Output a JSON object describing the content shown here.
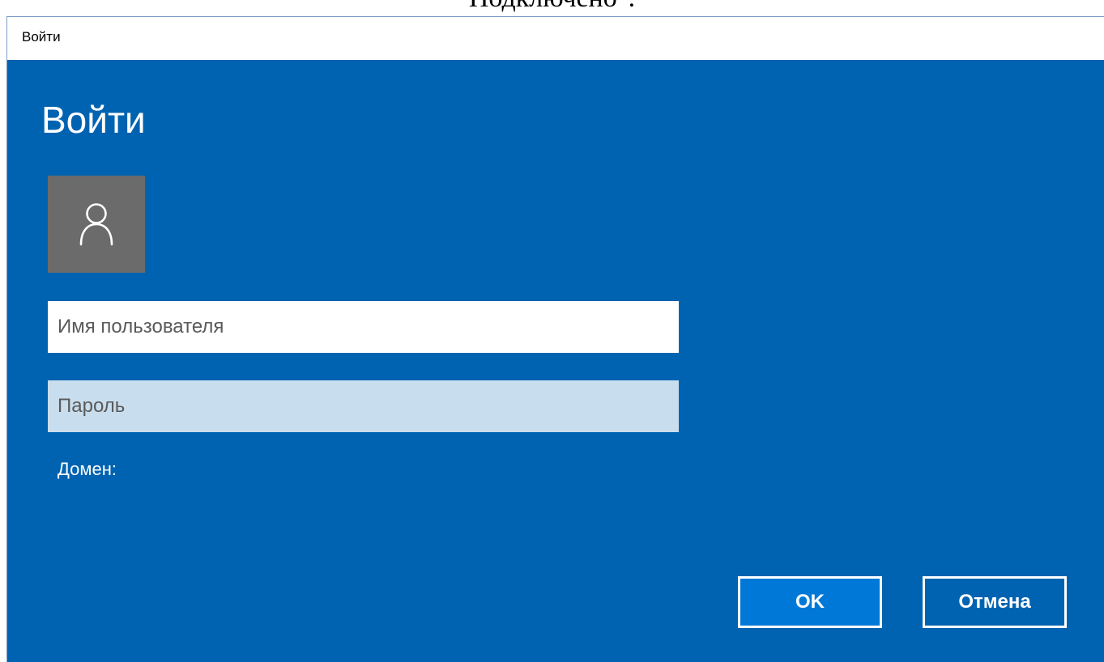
{
  "background_text": "Подключено\".",
  "window": {
    "title": "Войти"
  },
  "dialog": {
    "heading": "Войти",
    "avatar_icon": "user-icon",
    "username": {
      "value": "",
      "placeholder": "Имя пользователя"
    },
    "password": {
      "value": "",
      "placeholder": "Пароль"
    },
    "domain_label": "Домен:",
    "ok_label": "OK",
    "cancel_label": "Отмена"
  },
  "colors": {
    "dialog_background": "#0063b1",
    "avatar_background": "#6b6b6b",
    "password_field_background": "#c8dded",
    "ok_button": "#0078d7"
  }
}
